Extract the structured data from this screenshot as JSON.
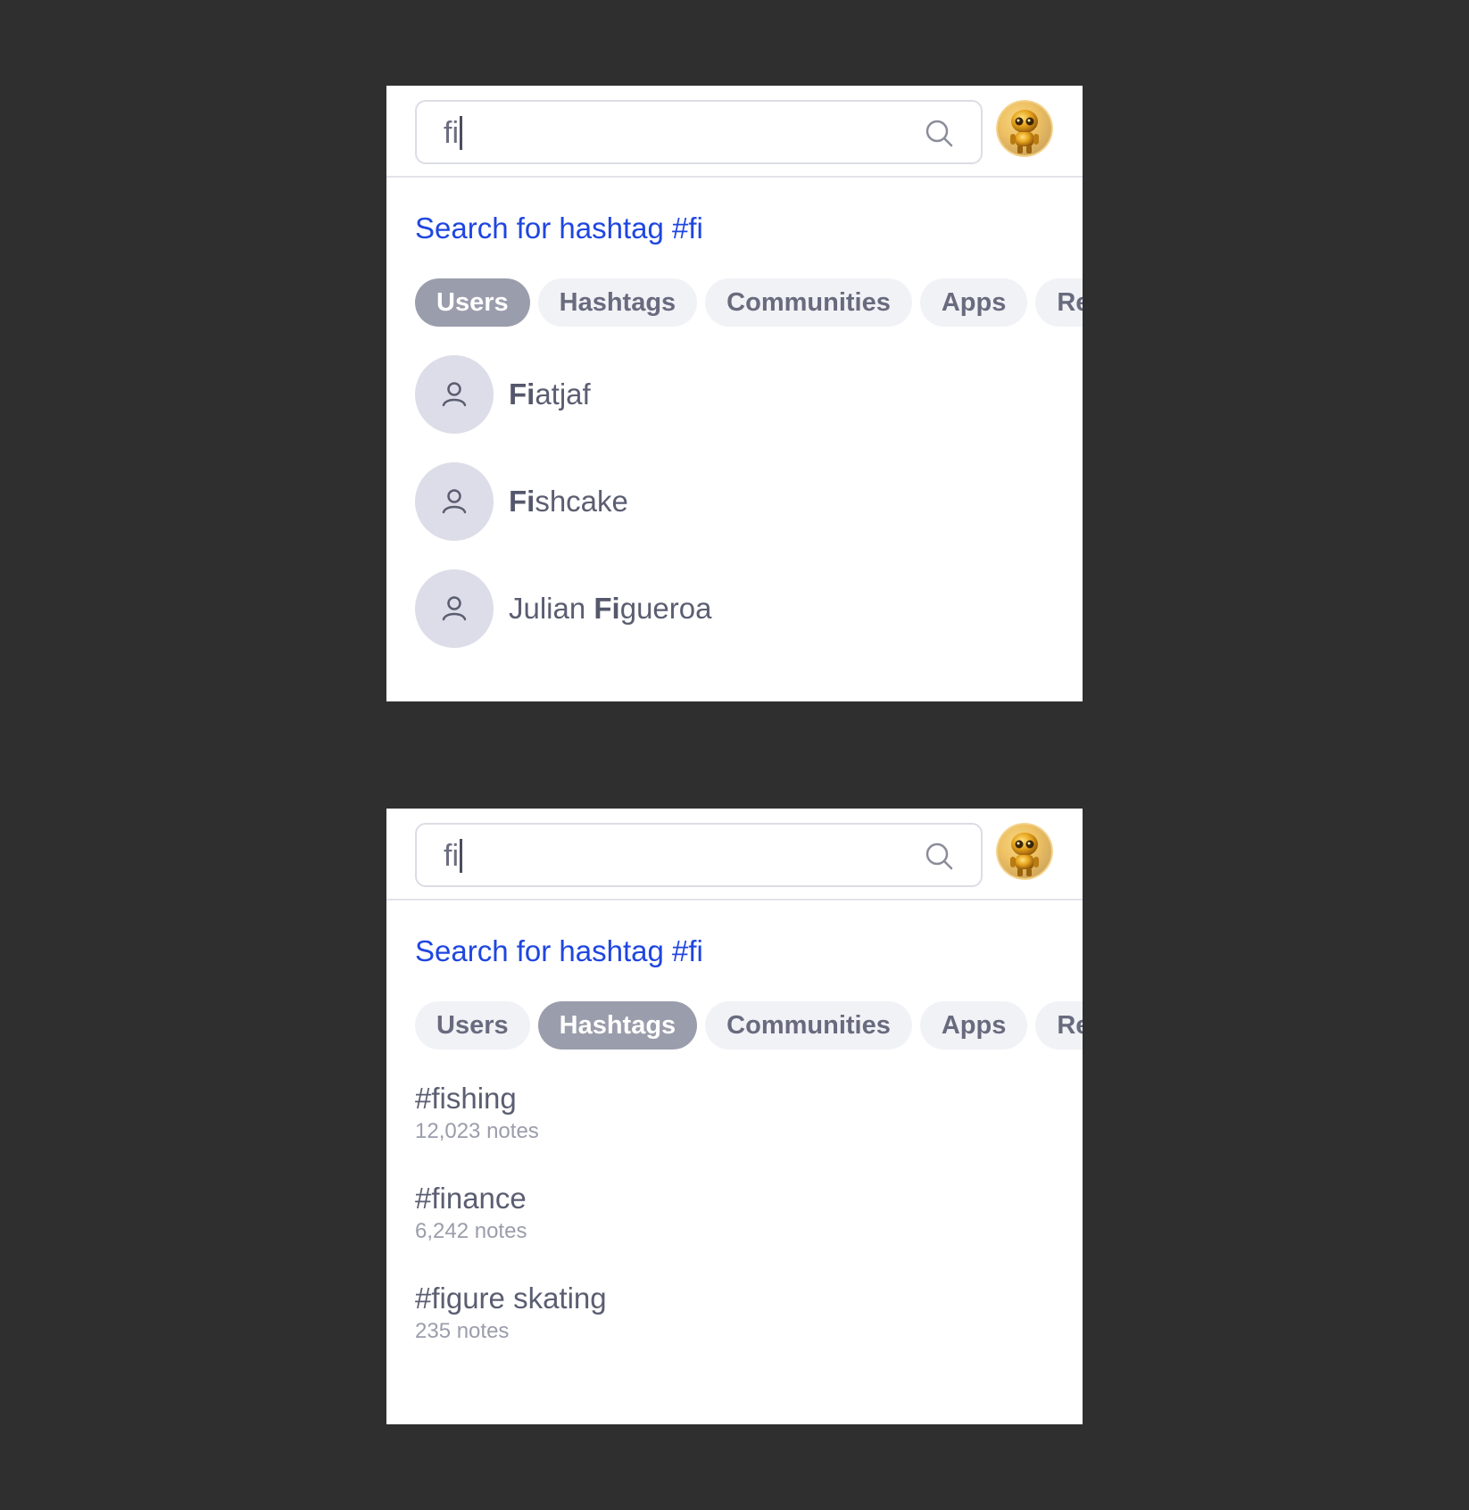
{
  "panels": [
    {
      "search": {
        "value": "fi",
        "icon": "search-icon"
      },
      "hashtag_link": "Search for hashtag #fi",
      "tabs": [
        "Users",
        "Hashtags",
        "Communities",
        "Apps",
        "Re"
      ],
      "active_tab": "Users",
      "users": [
        {
          "name_bold_prefix": "",
          "name_bold": "Fi",
          "name_rest": "atjaf"
        },
        {
          "name_bold_prefix": "",
          "name_bold": "Fi",
          "name_rest": "shcake"
        },
        {
          "name_bold_prefix": "Julian ",
          "name_bold": "Fi",
          "name_rest": "gueroa"
        }
      ]
    },
    {
      "search": {
        "value": "fi",
        "icon": "search-icon"
      },
      "hashtag_link": "Search for hashtag #fi",
      "tabs": [
        "Users",
        "Hashtags",
        "Communities",
        "Apps",
        "Re"
      ],
      "active_tab": "Hashtags",
      "hashtags": [
        {
          "tag": "#fishing",
          "count": "12,023 notes"
        },
        {
          "tag": "#finance",
          "count": "6,242 notes"
        },
        {
          "tag": "#figure skating",
          "count": "235 notes"
        }
      ]
    }
  ],
  "colors": {
    "background": "#2f2f2f",
    "link": "#1f46e0",
    "tab_active": "#9a9dab",
    "tab_inactive": "#f1f2f6"
  }
}
